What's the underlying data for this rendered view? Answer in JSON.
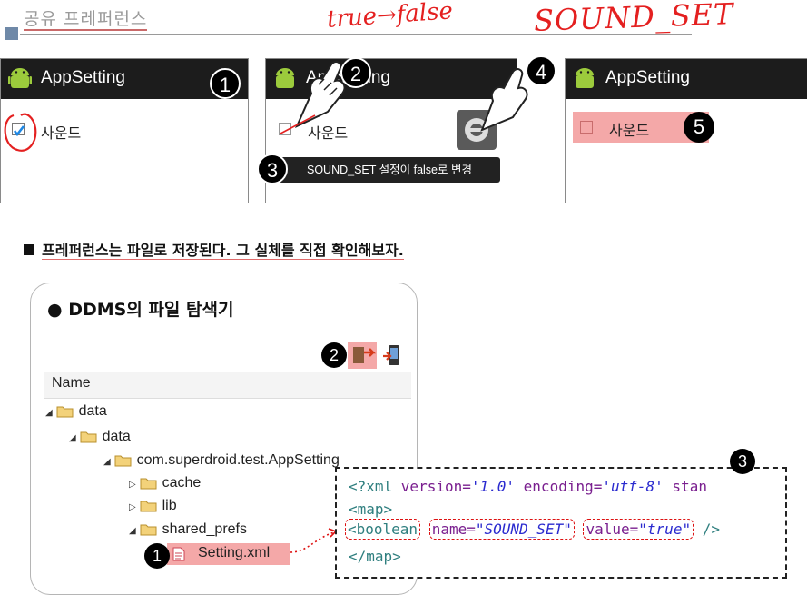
{
  "slide": {
    "title": "공유 프레퍼런스",
    "handwriting_left": "true→false",
    "handwriting_right": "SOUND_SET"
  },
  "screens": [
    {
      "app_title": "AppSetting",
      "checkbox_label": "사운드",
      "checked": true,
      "step": "1"
    },
    {
      "app_title": "AppSetting",
      "checkbox_label": "사운드",
      "checked": false,
      "steps": [
        "2",
        "3",
        "4"
      ],
      "toast": "SOUND_SET 설정이 false로 변경"
    },
    {
      "app_title": "AppSetting",
      "checkbox_label": "사운드",
      "checked": false,
      "step": "5"
    }
  ],
  "section": {
    "heading": "프레퍼런스는 파일로 저장된다. 그 실체를 직접 확인해보자."
  },
  "ddms": {
    "title": "● DDMS의 파일 탐색기",
    "toolbar_step": "2",
    "column_header": "Name",
    "tree": [
      {
        "label": "data"
      },
      {
        "label": "data"
      },
      {
        "label": "com.superdroid.test.AppSetting"
      },
      {
        "label": "cache"
      },
      {
        "label": "lib"
      },
      {
        "label": "shared_prefs"
      },
      {
        "label": "Setting.xml"
      }
    ],
    "file_step": "1"
  },
  "xml": {
    "step": "3",
    "line1": {
      "open": "<?xml ",
      "a1": "version=",
      "v1": "'1.0'",
      "a2": " encoding=",
      "v2": "'utf-8'",
      "rest": " stan"
    },
    "line2": "<map>",
    "line3": {
      "tag": "<boolean",
      "name_attr": "name=",
      "name_val": "\"SOUND_SET\"",
      "value_attr": "value=",
      "value_val": "\"true\"",
      "close": " />"
    },
    "line4": "</map>"
  },
  "colors": {
    "accent_red": "#e42020",
    "highlight_pink": "#f4a8a8",
    "android_green": "#9ccb3c"
  }
}
